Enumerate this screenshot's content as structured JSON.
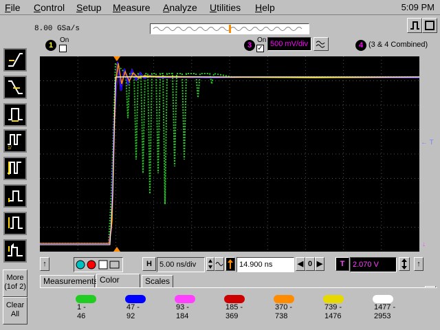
{
  "menu": {
    "items": [
      "File",
      "Control",
      "Setup",
      "Measure",
      "Analyze",
      "Utilities",
      "Help"
    ],
    "clock": "5:09 PM"
  },
  "acquisition": {
    "sample_rate": "8.00 GSa/s"
  },
  "channels": [
    {
      "number": "1",
      "on_label": "On",
      "checked": false,
      "color": "#ffff00"
    },
    {
      "number": "3",
      "on_label": "On",
      "checked": true,
      "color": "#ff00ff",
      "scale": "500 mV/div"
    },
    {
      "number": "4",
      "color": "#ff00ff",
      "label": "(3 & 4 Combined)"
    }
  ],
  "scope": {
    "trigger_marker": "← T",
    "bottom_marker": "↓"
  },
  "timebase": {
    "h_label": "H",
    "scale": "5.00 ns/div",
    "delay": "14.900 ns",
    "zero_label": "0"
  },
  "trigger": {
    "t_label": "T",
    "level": "2.070 V"
  },
  "side_buttons": {
    "more_label": "More",
    "more_sub": "(1of 2)",
    "clear_label": "Clear",
    "clear_sub": "All"
  },
  "tabs": [
    "Measurements",
    "Color Grade",
    "Scales"
  ],
  "active_tab": 1,
  "help_mark": "?",
  "color_grade": [
    {
      "from": "1 -",
      "to": "46",
      "color": "#22cc22"
    },
    {
      "from": "47 -",
      "to": "92",
      "color": "#0000ff"
    },
    {
      "from": "93 -",
      "to": "184",
      "color": "#ff40ff"
    },
    {
      "from": "185 -",
      "to": "369",
      "color": "#cc0000"
    },
    {
      "from": "370 -",
      "to": "738",
      "color": "#ff8c00"
    },
    {
      "from": "739 -",
      "to": "1476",
      "color": "#e6d800"
    },
    {
      "from": "1477 -",
      "to": "2953",
      "color": "#ffffff"
    }
  ]
}
